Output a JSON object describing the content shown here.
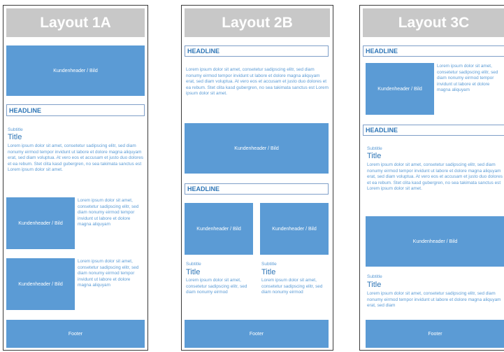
{
  "layouts": [
    {
      "title": "Layout 1A"
    },
    {
      "title": "Layout 2B"
    },
    {
      "title": "Layout 3C"
    }
  ],
  "labels": {
    "kundenheader": "Kundenheader / Bild",
    "headline": "HEADLINE",
    "subtitle": "Subtitle",
    "title": "Title",
    "footer": "Footer"
  },
  "text": {
    "long": "Lorem ipsum dolor sit amet, consetetur sadipscing elitr, sed diam nonumy eirmod tempor invidunt ut labore et dolore magna aliquyam erat, sed diam voluptua. At vero eos et accusam et justo duo dolores et ea rebum. Stet clita kasd gubergren, no sea takimata sanctus est Lorem ipsum dolor sit amet.",
    "side": "Lorem ipsum dolor sit amet, consetetur sadipscing elitr, sed diam nonumy eirmod tempor invidunt ut labore et dolore magna aliquyam",
    "col": "Lorem ipsum dolor sit amet, consetetur sadipscing elitr, sed diam nonumy eirmod",
    "short": "Lorem ipsum dolor sit amet, consetetur sadipscing elitr, sed diam nonumy eirmod tempor invidunt ut labore et dolore magna aliquyam erat, sed diam"
  }
}
